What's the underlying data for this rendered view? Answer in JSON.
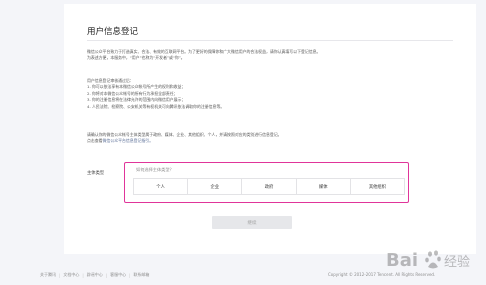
{
  "page": {
    "title": "用户信息登记",
    "intro": [
      "微信公众平台致力于打造真实、合法、有效的互联网平台。为了更好的保障你和广大微信用户的合法权益，请你认真填写以下登记信息。",
      "为表述方便，本服务中，“用户”也称为“开发者”或“你”。"
    ],
    "rules_heading": "用户信息登记审核通过后：",
    "rules": [
      "1. 你可以依法享有本微信公众帐号所产生的权利和收益；",
      "2. 你将对本微信公众帐号的所有行为承担全部责任；",
      "3. 你的注册信息将在法律允许的范围内向微信用户展示；",
      "4. 人民法院、检察院、公安机关等有权机关可向腾讯依法调取你的注册信息等。"
    ],
    "notice_line1": "请确认你的微信公众帐号主体类型属于政府、媒体、企业、其他组织、个人，并请按照对应的类别进行信息登记。",
    "notice_prefix": "点击查看",
    "notice_link": "微信公众平台信息登记指引。"
  },
  "form": {
    "label": "主体类型",
    "prompt": "如何选择主体类型？",
    "types": [
      "个人",
      "企业",
      "政府",
      "媒体",
      "其他组织"
    ]
  },
  "next_button": "继续",
  "footer": {
    "links": [
      "关于腾讯",
      "文档中心",
      "辟谣中心",
      "客服中心",
      "联系邮箱"
    ],
    "copyright": "Copyright © 2012-2017 Tencent. All Rights Reserved."
  },
  "watermark": "Bai 经验",
  "colors": {
    "highlight": "#e0359a",
    "link": "#576b95",
    "background": "#f4f5f9"
  }
}
